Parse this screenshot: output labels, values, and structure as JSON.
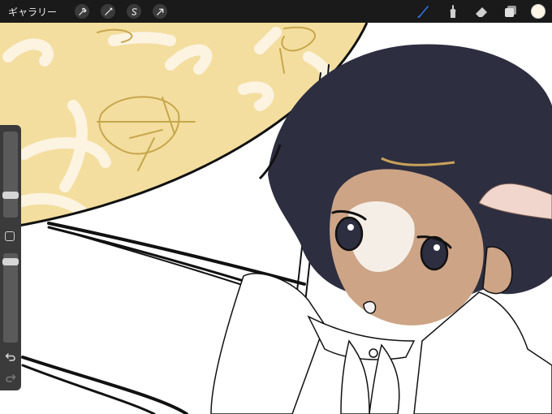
{
  "topbar": {
    "gallery_label": "ギャラリー",
    "tools_left": [
      "wrench-icon",
      "magic-wand-icon",
      "selection-icon",
      "transform-arrow-icon"
    ],
    "tools_right": [
      "brush-icon",
      "smudge-icon",
      "eraser-icon",
      "layers-icon",
      "color-swatch"
    ]
  },
  "sidebar": {
    "brush_size": 0.3,
    "opacity": 0.9,
    "tools": [
      "modify-button",
      "undo-icon",
      "redo-icon"
    ]
  },
  "colors": {
    "toolbar": "#1a1a1a",
    "active_brush": "#2d7cf6",
    "current_color": "#fdf6e6",
    "moon": "#f3de9f",
    "hair": "#2d2e40",
    "skin": "#cda486",
    "skin_highlight": "#f4eee6"
  }
}
